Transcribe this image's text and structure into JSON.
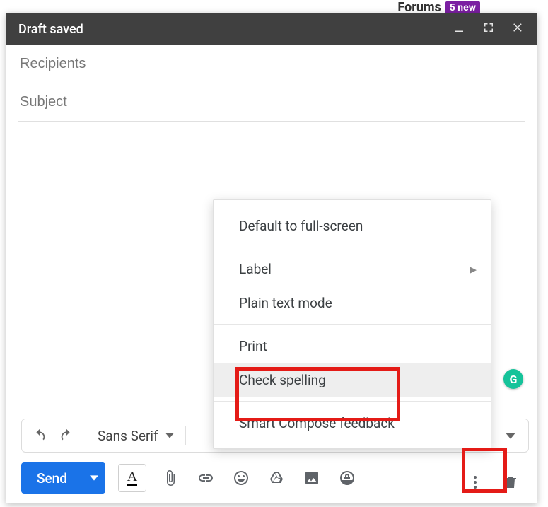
{
  "background": {
    "forums_label": "Forums",
    "forums_badge": "5 new"
  },
  "window": {
    "title": "Draft saved"
  },
  "fields": {
    "recipients_placeholder": "Recipients",
    "recipients_value": "",
    "subject_placeholder": "Subject",
    "subject_value": ""
  },
  "format_bar": {
    "font_family": "Sans Serif"
  },
  "send": {
    "label": "Send"
  },
  "more_menu": {
    "items": [
      {
        "label": "Default to full-screen",
        "has_submenu": false
      },
      {
        "label": "Label",
        "has_submenu": true
      },
      {
        "label": "Plain text mode",
        "has_submenu": false
      },
      {
        "label": "Print",
        "has_submenu": false
      },
      {
        "label": "Check spelling",
        "has_submenu": false,
        "hover": true
      },
      {
        "label": "Smart Compose feedback",
        "has_submenu": false
      }
    ]
  },
  "badges": {
    "grammarly": "G"
  },
  "icons": {
    "minimize": "minimize-icon",
    "fullscreen": "fullscreen-icon",
    "close": "close-icon",
    "undo": "undo-icon",
    "redo": "redo-icon",
    "caret_down": "caret-down-icon",
    "text_format": "text-format-icon",
    "attach": "attachment-icon",
    "link": "link-icon",
    "emoji": "emoji-icon",
    "drive": "drive-icon",
    "photo": "photo-icon",
    "confidential": "confidential-icon",
    "more": "more-options-icon",
    "trash": "trash-icon",
    "submenu_arrow": "chevron-right-icon"
  }
}
